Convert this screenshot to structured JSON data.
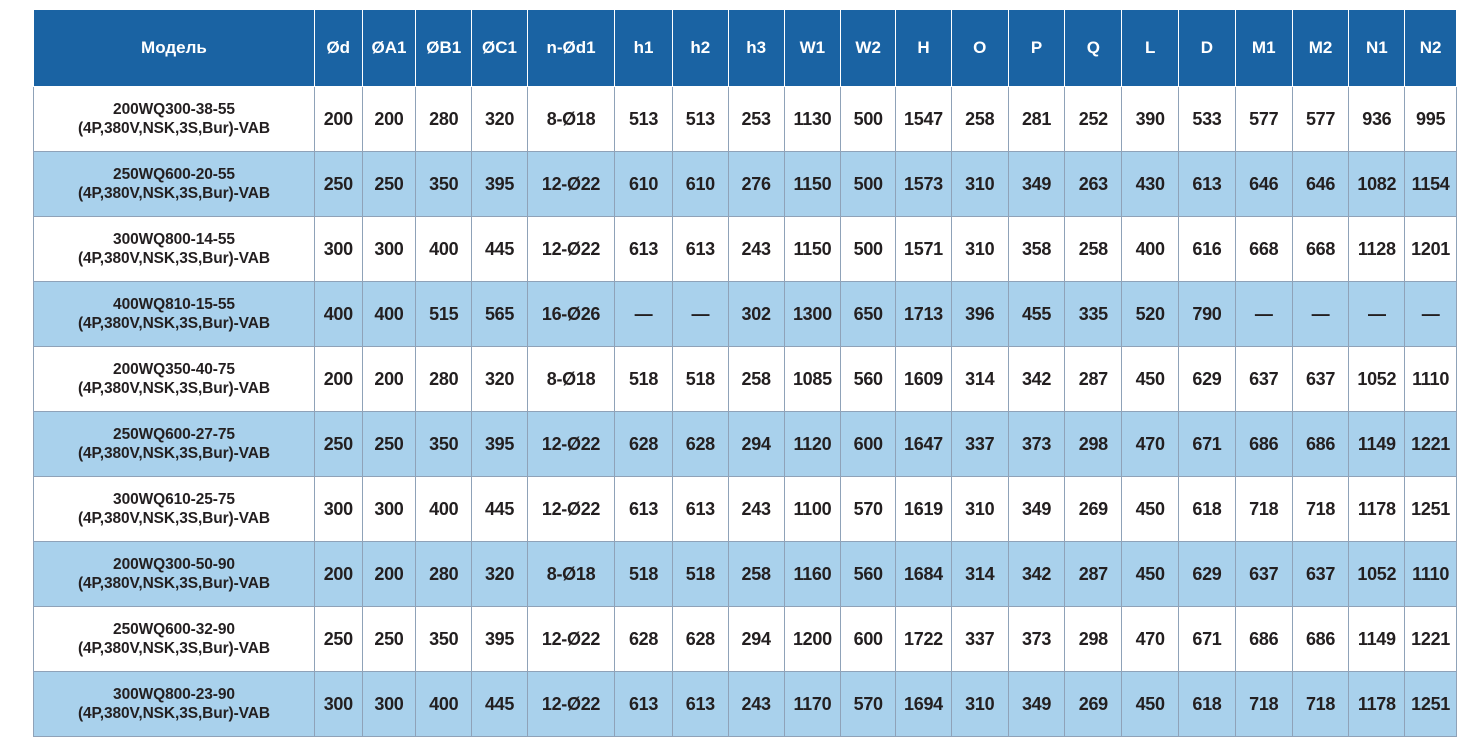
{
  "table": {
    "headers": [
      "Модель",
      "Ød",
      "ØA1",
      "ØB1",
      "ØC1",
      "n-Ød1",
      "h1",
      "h2",
      "h3",
      "W1",
      "W2",
      "H",
      "O",
      "P",
      "Q",
      "L",
      "D",
      "M1",
      "M2",
      "N1",
      "N2"
    ],
    "rows": [
      {
        "model": [
          "200WQ300-38-55",
          "(4P,380V,NSK,3S,Bur)-VAB"
        ],
        "cells": [
          "200",
          "200",
          "280",
          "320",
          "8-Ø18",
          "513",
          "513",
          "253",
          "1130",
          "500",
          "1547",
          "258",
          "281",
          "252",
          "390",
          "533",
          "577",
          "577",
          "936",
          "995"
        ]
      },
      {
        "model": [
          "250WQ600-20-55",
          "(4P,380V,NSK,3S,Bur)-VAB"
        ],
        "cells": [
          "250",
          "250",
          "350",
          "395",
          "12-Ø22",
          "610",
          "610",
          "276",
          "1150",
          "500",
          "1573",
          "310",
          "349",
          "263",
          "430",
          "613",
          "646",
          "646",
          "1082",
          "1154"
        ]
      },
      {
        "model": [
          "300WQ800-14-55",
          "(4P,380V,NSK,3S,Bur)-VAB"
        ],
        "cells": [
          "300",
          "300",
          "400",
          "445",
          "12-Ø22",
          "613",
          "613",
          "243",
          "1150",
          "500",
          "1571",
          "310",
          "358",
          "258",
          "400",
          "616",
          "668",
          "668",
          "1128",
          "1201"
        ]
      },
      {
        "model": [
          "400WQ810-15-55",
          "(4P,380V,NSK,3S,Bur)-VAB"
        ],
        "cells": [
          "400",
          "400",
          "515",
          "565",
          "16-Ø26",
          "—",
          "—",
          "302",
          "1300",
          "650",
          "1713",
          "396",
          "455",
          "335",
          "520",
          "790",
          "—",
          "—",
          "—",
          "—"
        ]
      },
      {
        "model": [
          "200WQ350-40-75",
          "(4P,380V,NSK,3S,Bur)-VAB"
        ],
        "cells": [
          "200",
          "200",
          "280",
          "320",
          "8-Ø18",
          "518",
          "518",
          "258",
          "1085",
          "560",
          "1609",
          "314",
          "342",
          "287",
          "450",
          "629",
          "637",
          "637",
          "1052",
          "1110"
        ]
      },
      {
        "model": [
          "250WQ600-27-75",
          "(4P,380V,NSK,3S,Bur)-VAB"
        ],
        "cells": [
          "250",
          "250",
          "350",
          "395",
          "12-Ø22",
          "628",
          "628",
          "294",
          "1120",
          "600",
          "1647",
          "337",
          "373",
          "298",
          "470",
          "671",
          "686",
          "686",
          "1149",
          "1221"
        ]
      },
      {
        "model": [
          "300WQ610-25-75",
          "(4P,380V,NSK,3S,Bur)-VAB"
        ],
        "cells": [
          "300",
          "300",
          "400",
          "445",
          "12-Ø22",
          "613",
          "613",
          "243",
          "1100",
          "570",
          "1619",
          "310",
          "349",
          "269",
          "450",
          "618",
          "718",
          "718",
          "1178",
          "1251"
        ]
      },
      {
        "model": [
          "200WQ300-50-90",
          "(4P,380V,NSK,3S,Bur)-VAB"
        ],
        "cells": [
          "200",
          "200",
          "280",
          "320",
          "8-Ø18",
          "518",
          "518",
          "258",
          "1160",
          "560",
          "1684",
          "314",
          "342",
          "287",
          "450",
          "629",
          "637",
          "637",
          "1052",
          "1110"
        ]
      },
      {
        "model": [
          "250WQ600-32-90",
          "(4P,380V,NSK,3S,Bur)-VAB"
        ],
        "cells": [
          "250",
          "250",
          "350",
          "395",
          "12-Ø22",
          "628",
          "628",
          "294",
          "1200",
          "600",
          "1722",
          "337",
          "373",
          "298",
          "470",
          "671",
          "686",
          "686",
          "1149",
          "1221"
        ]
      },
      {
        "model": [
          "300WQ800-23-90",
          "(4P,380V,NSK,3S,Bur)-VAB"
        ],
        "cells": [
          "300",
          "300",
          "400",
          "445",
          "12-Ø22",
          "613",
          "613",
          "243",
          "1170",
          "570",
          "1694",
          "310",
          "349",
          "269",
          "450",
          "618",
          "718",
          "718",
          "1178",
          "1251"
        ]
      }
    ]
  },
  "colors": {
    "header_bg": "#1a63a3",
    "header_text": "#ffffff",
    "alt_row_bg": "#a9d1ec",
    "plain_row_bg": "#ffffff",
    "cell_text": "#231f20"
  }
}
